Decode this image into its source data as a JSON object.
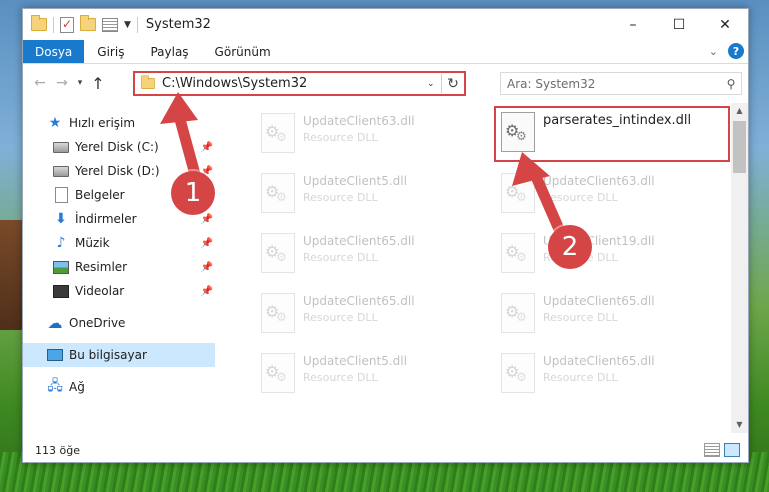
{
  "window": {
    "title": "System32",
    "controls": {
      "minimize": "–",
      "maximize": "☐",
      "close": "✕"
    }
  },
  "ribbon": {
    "tabs": [
      "Dosya",
      "Giriş",
      "Paylaş",
      "Görünüm"
    ],
    "help": "?"
  },
  "navigation": {
    "address": "C:\\Windows\\System32",
    "search_placeholder": "Ara: System32"
  },
  "sidebar": {
    "items": [
      {
        "label": "Hızlı erişim",
        "icon": "star-icon",
        "pinned": false
      },
      {
        "label": "Yerel Disk (C:)",
        "icon": "drive-icon",
        "pinned": true
      },
      {
        "label": "Yerel Disk (D:)",
        "icon": "drive-icon",
        "pinned": true
      },
      {
        "label": "Belgeler",
        "icon": "document-icon",
        "pinned": false
      },
      {
        "label": "İndirmeler",
        "icon": "download-icon",
        "pinned": true
      },
      {
        "label": "Müzik",
        "icon": "music-icon",
        "pinned": true
      },
      {
        "label": "Resimler",
        "icon": "pictures-icon",
        "pinned": true
      },
      {
        "label": "Videolar",
        "icon": "videos-icon",
        "pinned": true
      },
      {
        "label": "OneDrive",
        "icon": "cloud-icon",
        "pinned": false
      },
      {
        "label": "Bu bilgisayar",
        "icon": "computer-icon",
        "pinned": false,
        "selected": true
      },
      {
        "label": "Ağ",
        "icon": "network-icon",
        "pinned": false
      }
    ]
  },
  "files": [
    {
      "name": "UpdateClient63.dll",
      "type": "Resource DLL"
    },
    {
      "name": "parserates_intindex.dll",
      "type": ""
    },
    {
      "name": "UpdateClient5.dll",
      "type": "Resource DLL"
    },
    {
      "name": "UpdateClient63.dll",
      "type": "Resource DLL"
    },
    {
      "name": "UpdateClient65.dll",
      "type": "Resource DLL"
    },
    {
      "name": "UpdateClient19.dll",
      "type": "Resource DLL"
    },
    {
      "name": "UpdateClient65.dll",
      "type": "Resource DLL"
    },
    {
      "name": "UpdateClient65.dll",
      "type": "Resource DLL"
    },
    {
      "name": "UpdateClient5.dll",
      "type": "Resource DLL"
    },
    {
      "name": "UpdateClient65.dll",
      "type": "Resource DLL"
    }
  ],
  "status": {
    "item_count": "113 öğe"
  },
  "callouts": [
    "1",
    "2"
  ],
  "colors": {
    "accent": "#1979ca",
    "highlight": "#d64545",
    "selection": "#cce8ff"
  }
}
